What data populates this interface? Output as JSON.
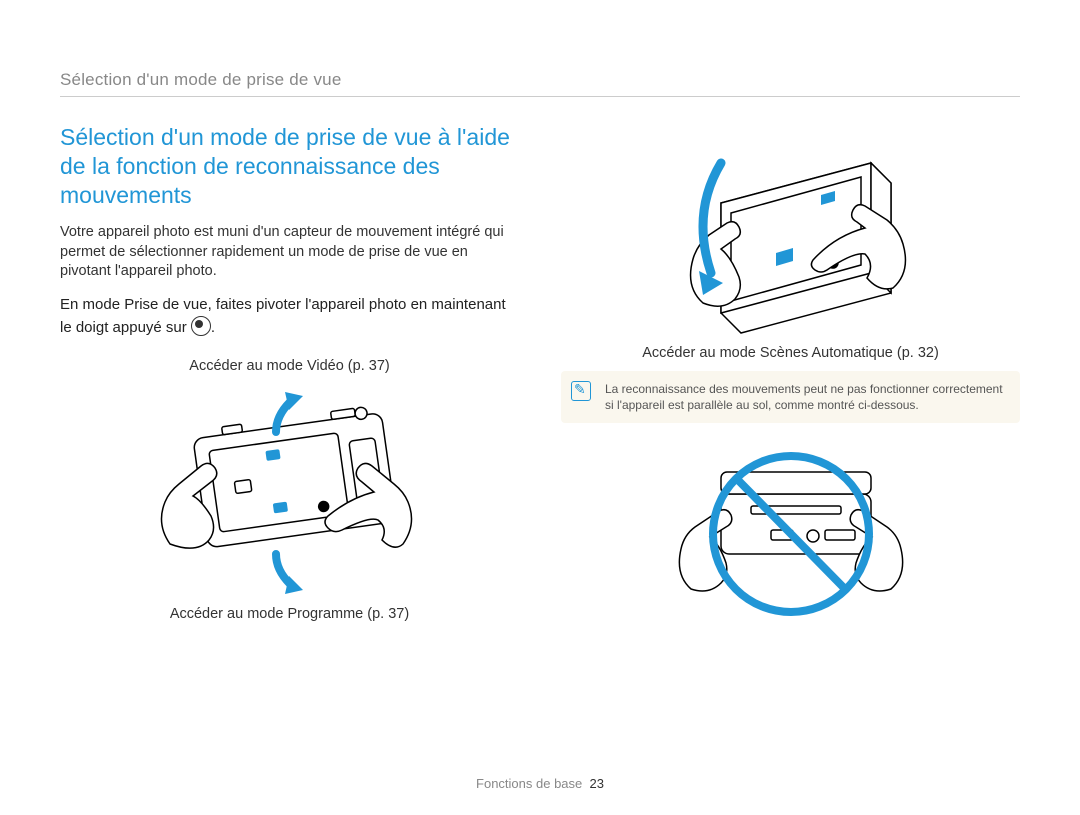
{
  "running_head": "Sélection d'un mode de prise de vue",
  "section_title": "Sélection d'un mode de prise de vue à l'aide de la fonction de reconnaissance des mouvements",
  "body_text": "Votre appareil photo est muni d'un capteur de mouvement intégré qui permet de sélectionner rapidement un mode de prise de vue en pivotant l'appareil photo.",
  "instruction_pre": "En mode Prise de vue, faites pivoter l'appareil photo en maintenant le doigt appuyé sur ",
  "instruction_post": ".",
  "caption_video": "Accéder au mode Vidéo (p. 37)",
  "caption_program": "Accéder au mode Programme (p. 37)",
  "caption_scene": "Accéder au mode Scènes Automatique (p. 32)",
  "note_text": "La reconnaissance des mouvements peut ne pas fonctionner correctement si l'appareil est parallèle au sol, comme montré ci-dessous.",
  "footer_label": "Fonctions de base",
  "page_number": "23"
}
